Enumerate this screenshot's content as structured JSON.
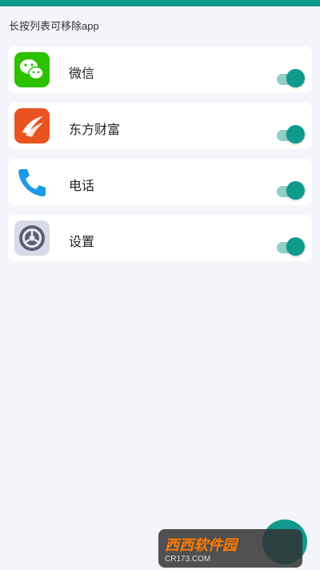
{
  "hint": "长按列表可移除app",
  "apps": [
    {
      "name": "微信",
      "enabled": true,
      "icon": "wechat-icon",
      "color": "#2dc100"
    },
    {
      "name": "东方财富",
      "enabled": true,
      "icon": "eastmoney-icon",
      "color": "#e8531f"
    },
    {
      "name": "电话",
      "enabled": true,
      "icon": "phone-icon",
      "color": "#1e9be8"
    },
    {
      "name": "设置",
      "enabled": true,
      "icon": "settings-gear-icon",
      "color": "#5a5f75"
    }
  ],
  "colors": {
    "accent": "#0f9a8c",
    "background": "#f4f5fa"
  },
  "watermark": {
    "name": "西西软件园",
    "site": "CR173.COM"
  }
}
